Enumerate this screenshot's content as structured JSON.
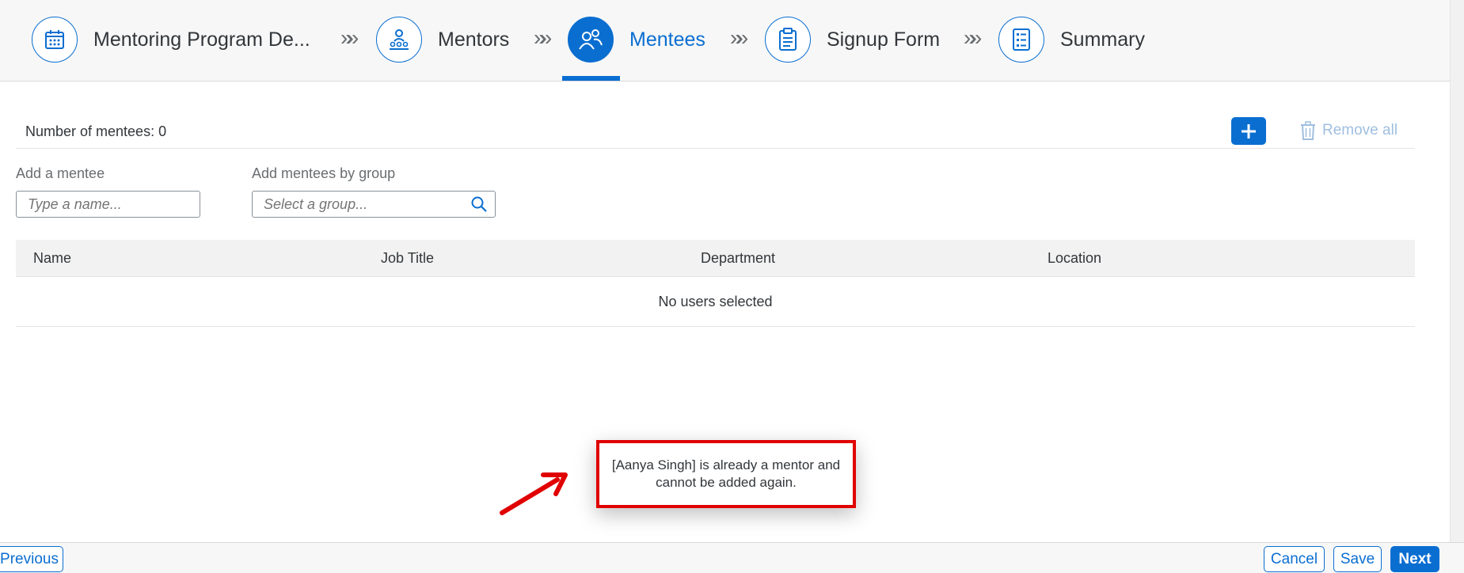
{
  "wizard": {
    "steps": [
      {
        "label": "Mentoring Program De...",
        "icon": "calendar-icon",
        "active": false
      },
      {
        "label": "Mentors",
        "icon": "group-icon",
        "active": false
      },
      {
        "label": "Mentees",
        "icon": "people-icon",
        "active": true
      },
      {
        "label": "Signup Form",
        "icon": "clipboard-icon",
        "active": false
      },
      {
        "label": "Summary",
        "icon": "checklist-icon",
        "active": false
      }
    ],
    "separator": "»»"
  },
  "mentees": {
    "count_label": "Number of mentees: 0",
    "add_button_icon": "plus-icon",
    "remove_all_label": "Remove all",
    "add_mentee_label": "Add a mentee",
    "add_mentee_placeholder": "Type a name...",
    "add_group_label": "Add mentees by group",
    "add_group_placeholder": "Select a group..."
  },
  "table": {
    "columns": [
      "Name",
      "Job Title",
      "Department",
      "Location"
    ],
    "empty_text": "No users selected"
  },
  "message": {
    "text": "[Aanya Singh] is already a mentor and cannot be added again."
  },
  "footer": {
    "previous": "Previous",
    "cancel": "Cancel",
    "save": "Save",
    "next": "Next"
  },
  "colors": {
    "accent": "#0a6ed1",
    "highlight": "#e00000"
  }
}
